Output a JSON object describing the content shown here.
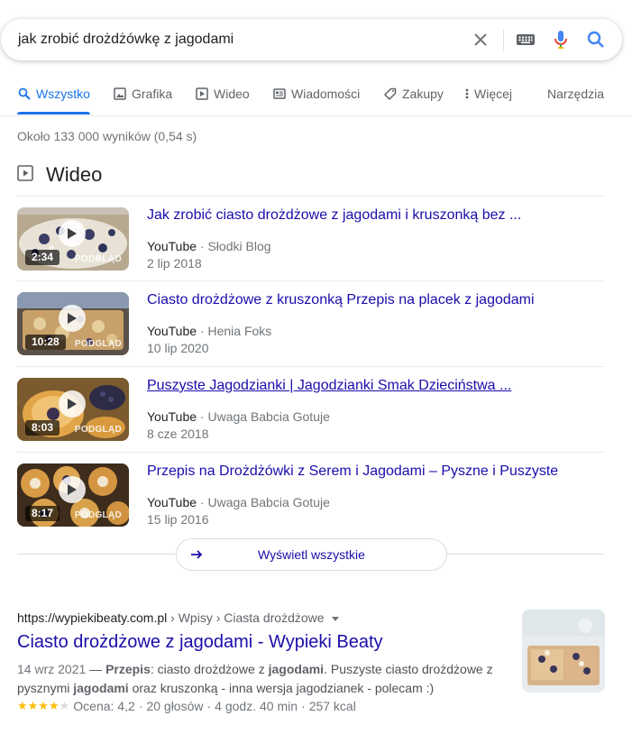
{
  "search": {
    "query": "jak zrobić drożdżówkę z jagodami"
  },
  "tabs": [
    {
      "label": "Wszystko",
      "icon": "search-icon",
      "active": true
    },
    {
      "label": "Grafika",
      "icon": "image-icon"
    },
    {
      "label": "Wideo",
      "icon": "video-icon"
    },
    {
      "label": "Wiadomości",
      "icon": "news-icon"
    },
    {
      "label": "Zakupy",
      "icon": "tag-icon"
    },
    {
      "label": "Więcej",
      "icon": "more-vert-icon"
    },
    {
      "label": "Narzędzia"
    }
  ],
  "result_stats": "Około 133 000 wyników (0,54 s)",
  "video_section": {
    "heading": "Wideo",
    "view_all_label": "Wyświetl wszystkie",
    "items": [
      {
        "title": "Jak zrobić ciasto drożdżowe z jagodami i kruszonką bez ...",
        "platform": "YouTube",
        "author": "Słodki Blog",
        "date": "2 lip 2018",
        "duration": "2:34",
        "preview": "PODGLĄD"
      },
      {
        "title": "Ciasto drożdżowe z kruszonką Przepis na placek z jagodami",
        "platform": "YouTube",
        "author": "Henia Foks",
        "date": "10 lip 2020",
        "duration": "10:28",
        "preview": "PODGLĄD"
      },
      {
        "title": "Puszyste Jagodzianki | Jagodzianki Smak Dzieciństwa ...",
        "platform": "YouTube",
        "author": "Uwaga Babcia Gotuje",
        "date": "8 cze 2018",
        "duration": "8:03",
        "preview": "PODGLĄD"
      },
      {
        "title": "Przepis na Drożdżówki z Serem i Jagodami – Pyszne i Puszyste",
        "platform": "YouTube",
        "author": "Uwaga Babcia Gotuje",
        "date": "15 lip 2016",
        "duration": "8:17",
        "preview": "PODGLĄD"
      }
    ]
  },
  "web_result": {
    "url": "https://wypiekibeaty.com.pl",
    "breadcrumb": " › Wpisy › Ciasta drożdżowe",
    "title": "Ciasto drożdżowe z jagodami - Wypieki Beaty",
    "date": "14 wrz 2021",
    "snippet_sep": " — ",
    "snippet_b1": "Przepis",
    "snippet_t1": ": ciasto drożdżowe z ",
    "snippet_b2": "jagodami",
    "snippet_t2": ". Puszyste ciasto drożdżowe z pysznymi ",
    "snippet_b3": "jagodami",
    "snippet_t3": " oraz kruszonką - inna wersja jagodzianek - polecam :)",
    "rating_stars": 4.2,
    "rating": "Ocena: 4,2",
    "votes": "20 głosów",
    "time": "4 godz. 40 min",
    "kcal": "257 kcal",
    "sep": " · "
  },
  "colors": {
    "link": "#1a0dab",
    "accent": "#1a73e8",
    "muted": "#70757a",
    "star": "#fbbc04"
  }
}
